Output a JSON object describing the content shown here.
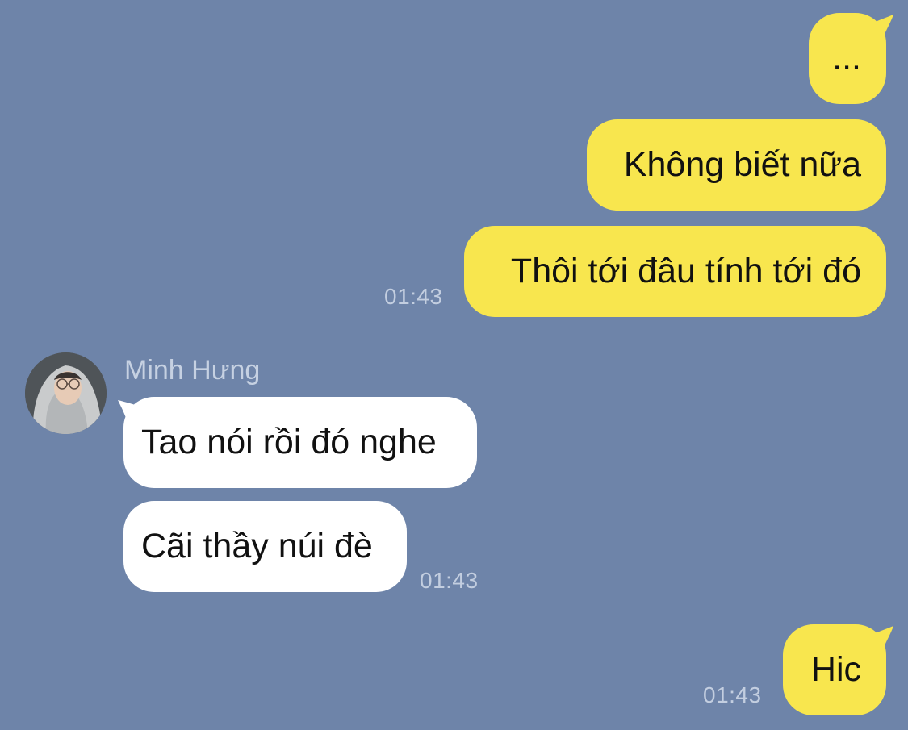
{
  "colors": {
    "background": "#6e84a9",
    "outgoing_bubble": "#f8e64e",
    "incoming_bubble": "#ffffff",
    "timestamp": "#c3cee0"
  },
  "messages": {
    "out1": {
      "text": "..."
    },
    "out2": {
      "text": "Không biết nữa"
    },
    "out3": {
      "text": "Thôi tới đâu tính tới đó",
      "time": "01:43"
    },
    "contact": {
      "name": "Minh Hưng",
      "avatar_icon": "user-avatar-photo"
    },
    "in1": {
      "text": "Tao nói rồi đó nghe"
    },
    "in2": {
      "text": "Cãi thầy núi đè",
      "time": "01:43"
    },
    "out4": {
      "text": "Hic",
      "time": "01:43"
    }
  }
}
